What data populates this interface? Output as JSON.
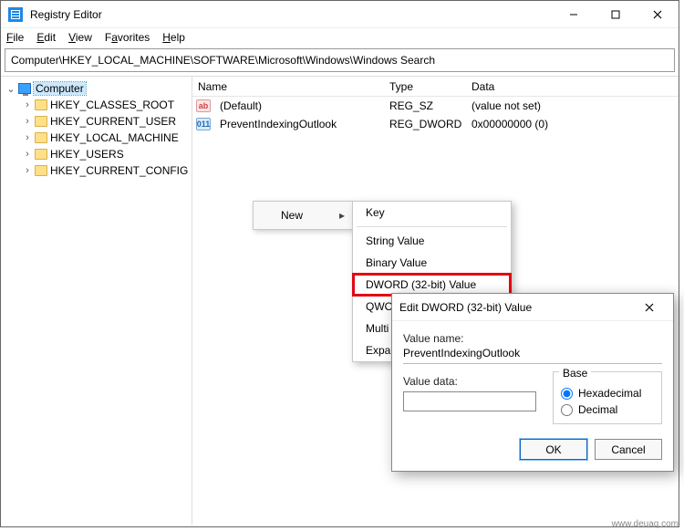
{
  "titlebar": {
    "title": "Registry Editor"
  },
  "menubar": {
    "file": "File",
    "edit": "Edit",
    "view": "View",
    "favorites": "Favorites",
    "help": "Help"
  },
  "address": "Computer\\HKEY_LOCAL_MACHINE\\SOFTWARE\\Microsoft\\Windows\\Windows Search",
  "tree": {
    "root": "Computer",
    "children": [
      "HKEY_CLASSES_ROOT",
      "HKEY_CURRENT_USER",
      "HKEY_LOCAL_MACHINE",
      "HKEY_USERS",
      "HKEY_CURRENT_CONFIG"
    ]
  },
  "list": {
    "headers": {
      "name": "Name",
      "type": "Type",
      "data": "Data"
    },
    "rows": [
      {
        "icon": "str",
        "name": "(Default)",
        "type": "REG_SZ",
        "data": "(value not set)"
      },
      {
        "icon": "dw",
        "name": "PreventIndexingOutlook",
        "type": "REG_DWORD",
        "data": "0x00000000 (0)"
      }
    ]
  },
  "context": {
    "parent": "New",
    "items": [
      "Key",
      "String Value",
      "Binary Value",
      "DWORD (32-bit) Value",
      "QWORD (64-bit) Value",
      "Multi",
      "Expa"
    ],
    "highlight_index": 3
  },
  "dialog": {
    "title": "Edit DWORD (32-bit) Value",
    "valuename_label": "Value name:",
    "valuename": "PreventIndexingOutlook",
    "valuedata_label": "Value data:",
    "valuedata": "",
    "base_label": "Base",
    "hex_label": "Hexadecimal",
    "dec_label": "Decimal",
    "selected_base": "hex",
    "ok": "OK",
    "cancel": "Cancel"
  },
  "watermark": "www.deuaq.com"
}
